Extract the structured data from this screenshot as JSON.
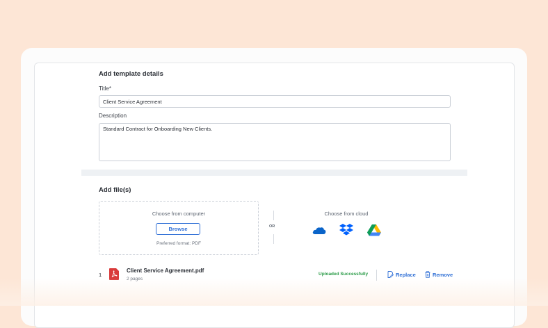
{
  "template_details": {
    "section_title": "Add template details",
    "title_label": "Title*",
    "title_value": "Client Service Agreement",
    "description_label": "Description",
    "description_value": "Standard Contract for Onboarding New Clients."
  },
  "files": {
    "section_title": "Add file(s)",
    "computer": {
      "heading": "Choose from computer",
      "browse_label": "Browse",
      "hint": "Preferred format: PDF"
    },
    "or_label": "OR",
    "cloud": {
      "heading": "Choose from cloud",
      "providers": [
        "onedrive-icon",
        "dropbox-icon",
        "google-drive-icon"
      ]
    },
    "items": [
      {
        "index": "1",
        "name": "Client Service Agreement.pdf",
        "pages": "2 pages",
        "status": "Uploaded Successfully",
        "replace_label": "Replace",
        "remove_label": "Remove"
      }
    ]
  },
  "colors": {
    "background": "#fde6d6",
    "accent": "#2f6fd6",
    "success": "#2a9b47",
    "pdf": "#d93b3b"
  }
}
